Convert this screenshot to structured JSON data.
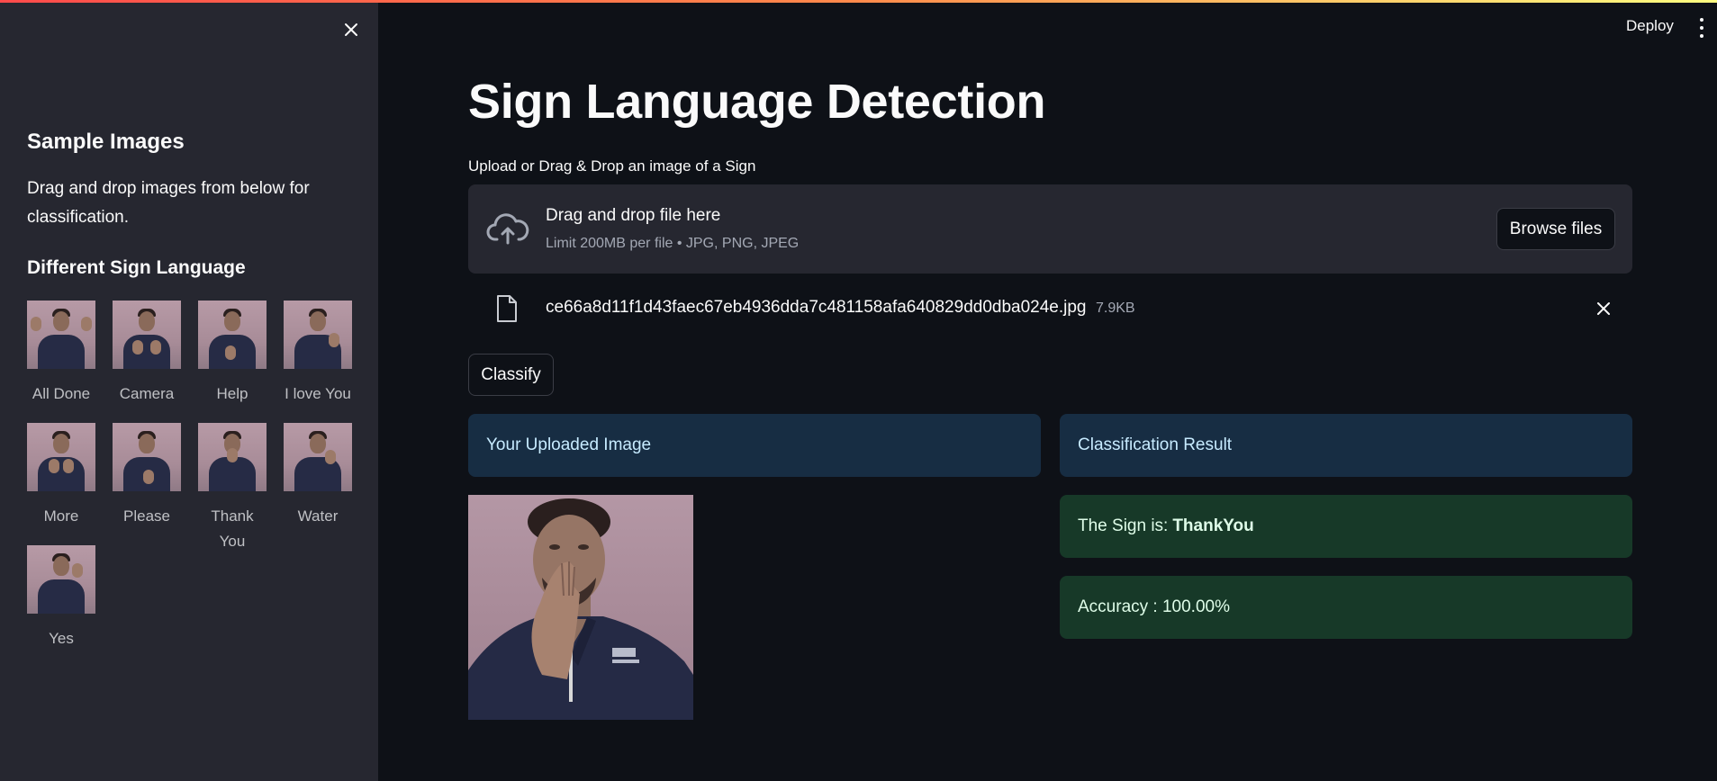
{
  "app": {
    "deploy_label": "Deploy"
  },
  "sidebar": {
    "heading": "Sample Images",
    "description": "Drag and drop images from below for classification.",
    "subheading": "Different Sign Language",
    "samples": [
      {
        "label": "All Done"
      },
      {
        "label": "Camera"
      },
      {
        "label": "Help"
      },
      {
        "label": "I love You"
      },
      {
        "label": "More"
      },
      {
        "label": "Please"
      },
      {
        "label": "Thank You"
      },
      {
        "label": "Water"
      },
      {
        "label": "Yes"
      }
    ]
  },
  "main": {
    "title": "Sign Language Detection",
    "uploader": {
      "label": "Upload or Drag & Drop an image of a Sign",
      "drop_text": "Drag and drop file here",
      "limit_text": "Limit 200MB per file • JPG, PNG, JPEG",
      "browse_label": "Browse files"
    },
    "file": {
      "name": "ce66a8d11f1d43faec67eb4936dda7c481158afa640829dd0dba024e.jpg",
      "size": "7.9KB"
    },
    "classify_label": "Classify",
    "uploaded_header": "Your Uploaded Image",
    "result_header": "Classification Result",
    "result_prefix": "The Sign is:",
    "result_value": "ThankYou",
    "accuracy_text": "Accuracy : 100.00%"
  },
  "colors": {
    "background": "#0e1117",
    "sidebar": "#262730",
    "info_bg": "#172d43",
    "info_text": "#c7ebff",
    "success_bg": "#173928",
    "success_text": "#dffde9"
  }
}
